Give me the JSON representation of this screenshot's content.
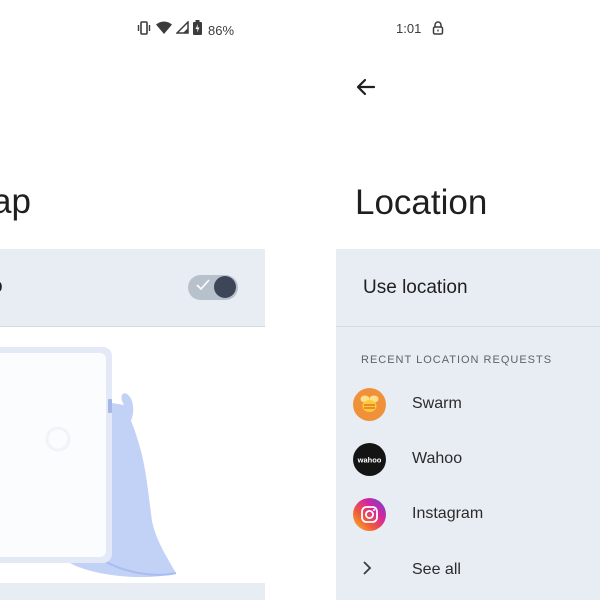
{
  "left_screen": {
    "status": {
      "battery_percent": "86%"
    },
    "title": "ap",
    "toggle_row_label": "o",
    "toggle_on": true
  },
  "right_screen": {
    "status": {
      "time": "1:01"
    },
    "title": "Location",
    "use_location_label": "Use location",
    "section_header": "RECENT LOCATION REQUESTS",
    "apps": [
      {
        "name": "Swarm",
        "icon": "swarm-icon",
        "color": "#f0913a"
      },
      {
        "name": "Wahoo",
        "icon": "wahoo-icon",
        "color": "#141414",
        "icon_text": "wahoo"
      },
      {
        "name": "Instagram",
        "icon": "instagram-icon",
        "color": "#d6249f"
      }
    ],
    "see_all_label": "See all"
  },
  "colors": {
    "row_background": "#e8ecf3",
    "toggle_track": "#b7c1cc",
    "toggle_thumb": "#3c4656",
    "illustration_hand": "#c2d1f6"
  }
}
